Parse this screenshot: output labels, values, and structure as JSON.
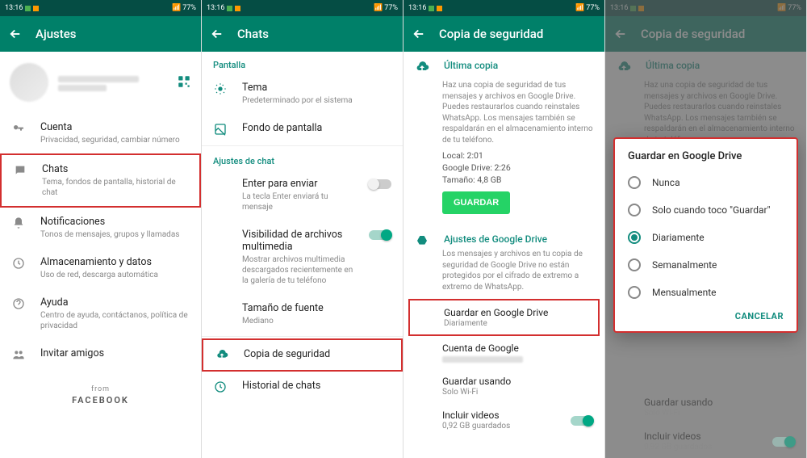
{
  "status": {
    "time": "13:16",
    "battery": "77%"
  },
  "screen1": {
    "title": "Ajustes",
    "items": [
      {
        "title": "Cuenta",
        "sub": "Privacidad, seguridad, cambiar número"
      },
      {
        "title": "Chats",
        "sub": "Tema, fondos de pantalla, historial de chat"
      },
      {
        "title": "Notificaciones",
        "sub": "Tonos de mensajes, grupos y llamadas"
      },
      {
        "title": "Almacenamiento y datos",
        "sub": "Uso de red, descarga automática"
      },
      {
        "title": "Ayuda",
        "sub": "Centro de ayuda, contáctanos, política de privacidad"
      },
      {
        "title": "Invitar amigos",
        "sub": ""
      }
    ],
    "from": "from",
    "fb": "FACEBOOK"
  },
  "screen2": {
    "title": "Chats",
    "sec1": "Pantalla",
    "theme": {
      "title": "Tema",
      "sub": "Predeterminado por el sistema"
    },
    "wallpaper": "Fondo de pantalla",
    "sec2": "Ajustes de chat",
    "enter": {
      "title": "Enter para enviar",
      "sub": "La tecla Enter enviará tu mensaje"
    },
    "media": {
      "title": "Visibilidad de archivos multimedia",
      "sub": "Mostrar archivos multimedia descargados recientemente en la galería de tu teléfono"
    },
    "font": {
      "title": "Tamaño de fuente",
      "sub": "Mediano"
    },
    "backup": "Copia de seguridad",
    "history": "Historial de chats"
  },
  "screen3": {
    "title": "Copia de seguridad",
    "last": "Última copia",
    "desc": "Haz una copia de seguridad de tus mensajes y archivos en Google Drive. Puedes restaurarlos cuando reinstales WhatsApp. Los mensajes también se respaldarán en el almacenamiento interno de tu teléfono.",
    "local": "Local: 2:01",
    "gdrive": "Google Drive: 2:26",
    "size": "Tamaño: 4,8 GB",
    "save_btn": "GUARDAR",
    "gd_settings": "Ajustes de Google Drive",
    "gd_desc": "Los mensajes y archivos en tu copia de seguridad de Google Drive no están protegidos por el cifrado de extremo a extremo de WhatsApp.",
    "save_gd": {
      "title": "Guardar en Google Drive",
      "sub": "Diariamente"
    },
    "account": "Cuenta de Google",
    "save_using": {
      "title": "Guardar usando",
      "sub": "Solo Wi-Fi"
    },
    "videos": {
      "title": "Incluir videos",
      "sub": "0,92 GB guardados"
    }
  },
  "screen4": {
    "title": "Copia de seguridad",
    "dialog_title": "Guardar en Google Drive",
    "options": [
      "Nunca",
      "Solo cuando toco \"Guardar\"",
      "Diariamente",
      "Semanalmente",
      "Mensualmente"
    ],
    "selected": 2,
    "cancel": "CANCELAR"
  }
}
